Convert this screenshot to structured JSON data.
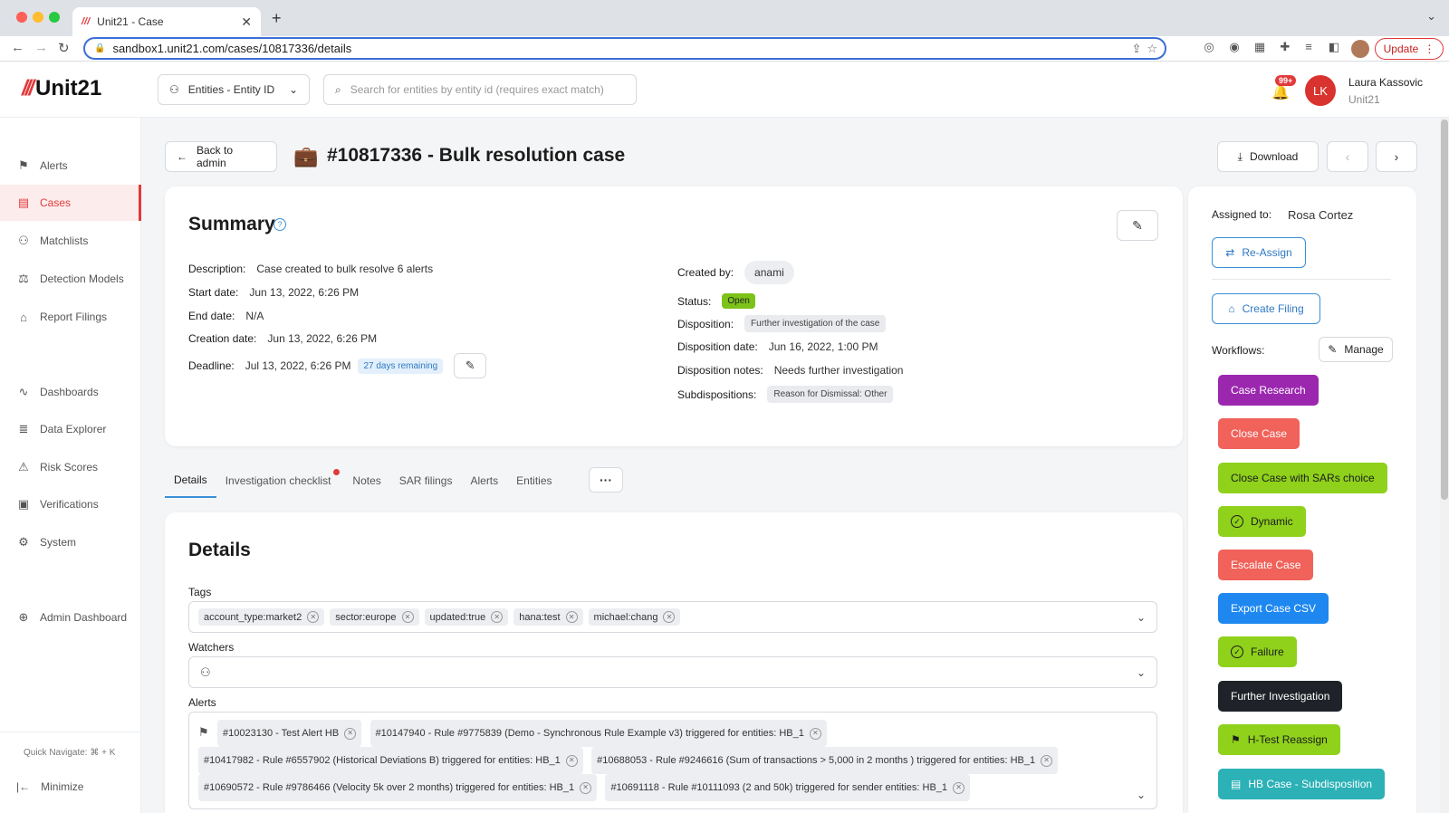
{
  "browser": {
    "tab_title": "Unit21 - Case",
    "tab_favicon": "///",
    "url": "sandbox1.unit21.com/cases/10817336/details",
    "update_label": "Update"
  },
  "header": {
    "logo_slashes": "///",
    "logo_text": "Unit21",
    "entity_select": "Entities - Entity ID",
    "search_placeholder": "Search for entities by entity id (requires exact match)",
    "notif_badge": "99+",
    "avatar_initials": "LK",
    "user_name": "Laura Kassovic",
    "user_org": "Unit21"
  },
  "sidebar": {
    "items": [
      {
        "label": "Alerts",
        "icon": "⚑"
      },
      {
        "label": "Cases",
        "icon": "▤"
      },
      {
        "label": "Matchlists",
        "icon": "⚇"
      },
      {
        "label": "Detection Models",
        "icon": "⚖"
      },
      {
        "label": "Report Filings",
        "icon": "⌂"
      },
      {
        "label": "Dashboards",
        "icon": "∿"
      },
      {
        "label": "Data Explorer",
        "icon": "≣"
      },
      {
        "label": "Risk Scores",
        "icon": "⚠"
      },
      {
        "label": "Verifications",
        "icon": "▣"
      },
      {
        "label": "System",
        "icon": "⚙"
      },
      {
        "label": "Admin Dashboard",
        "icon": "⊕"
      }
    ],
    "quick_navigate": "Quick Navigate: ⌘ + K",
    "minimize": "Minimize"
  },
  "case": {
    "back_label": "Back to admin",
    "title": "#10817336 - Bulk resolution case",
    "download_label": "Download"
  },
  "summary": {
    "title": "Summary",
    "left": [
      {
        "label": "Description:",
        "value": "Case created to bulk resolve 6 alerts"
      },
      {
        "label": "Start date:",
        "value": "Jun 13, 2022, 6:26 PM"
      },
      {
        "label": "End date:",
        "value": "N/A"
      },
      {
        "label": "Creation date:",
        "value": "Jun 13, 2022, 6:26 PM"
      },
      {
        "label": "Deadline:",
        "value": "Jul 13, 2022, 6:26 PM"
      }
    ],
    "deadline_chip": "27 days remaining",
    "created_by_label": "Created by:",
    "created_by": "anami",
    "status_label": "Status:",
    "status": "Open",
    "disposition_label": "Disposition:",
    "disposition": "Further investigation of the case",
    "disposition_date_label": "Disposition date:",
    "disposition_date": "Jun 16, 2022, 1:00 PM",
    "disposition_notes_label": "Disposition notes:",
    "disposition_notes": "Needs further investigation",
    "subdispositions_label": "Subdispositions:",
    "subdisposition": "Reason for Dismissal: Other"
  },
  "tabs": [
    "Details",
    "Investigation checklist",
    "Notes",
    "SAR filings",
    "Alerts",
    "Entities"
  ],
  "more_label": "···",
  "details": {
    "title": "Details",
    "tags_label": "Tags",
    "tags": [
      "account_type:market2",
      "sector:europe",
      "updated:true",
      "hana:test",
      "michael:chang"
    ],
    "watchers_label": "Watchers",
    "alerts_label": "Alerts",
    "alerts": [
      "#10023130 - Test Alert HB",
      "#10147940 - Rule #9775839 (Demo - Synchronous Rule Example v3) triggered for entities: HB_1",
      "#10417982 - Rule #6557902 (Historical Deviations B) triggered for entities: HB_1",
      "#10688053 - Rule #9246616 (Sum of transactions > 5,000 in 2 months ) triggered for entities: HB_1",
      "#10690572 - Rule #9786466 (Velocity 5k over 2 months) triggered for entities: HB_1",
      "#10691118 - Rule #10111093 (2 and 50k) triggered for sender entities: HB_1"
    ]
  },
  "right_panel": {
    "assigned_label": "Assigned to:",
    "assigned_to": "Rosa Cortez",
    "reassign_label": "Re-Assign",
    "create_filing_label": "Create Filing",
    "workflows_label": "Workflows:",
    "manage_label": "Manage",
    "workflows": [
      {
        "label": "Case Research",
        "bg": "#9b27af",
        "fg": "#ffffff",
        "icon": ""
      },
      {
        "label": "Close Case",
        "bg": "#f0625a",
        "fg": "#ffffff",
        "icon": ""
      },
      {
        "label": "Close Case with SARs choice",
        "bg": "#8fd11b",
        "fg": "#1c1c1c",
        "icon": ""
      },
      {
        "label": "Dynamic",
        "bg": "#8fd11b",
        "fg": "#1c1c1c",
        "icon": "✓"
      },
      {
        "label": "Escalate Case",
        "bg": "#f0625a",
        "fg": "#ffffff",
        "icon": ""
      },
      {
        "label": "Export Case CSV",
        "bg": "#1e88f0",
        "fg": "#ffffff",
        "icon": ""
      },
      {
        "label": "Failure",
        "bg": "#8fd11b",
        "fg": "#1c1c1c",
        "icon": "✓"
      },
      {
        "label": "Further Investigation",
        "bg": "#1f2329",
        "fg": "#ffffff",
        "icon": ""
      },
      {
        "label": "H-Test Reassign",
        "bg": "#8fd11b",
        "fg": "#1c1c1c",
        "icon": "⚑"
      },
      {
        "label": "HB Case - Subdisposition",
        "bg": "#2bb1b6",
        "fg": "#ffffff",
        "icon": "▤"
      }
    ]
  },
  "colors": {
    "accent": "#e2393b",
    "link": "#3b8fd6"
  }
}
